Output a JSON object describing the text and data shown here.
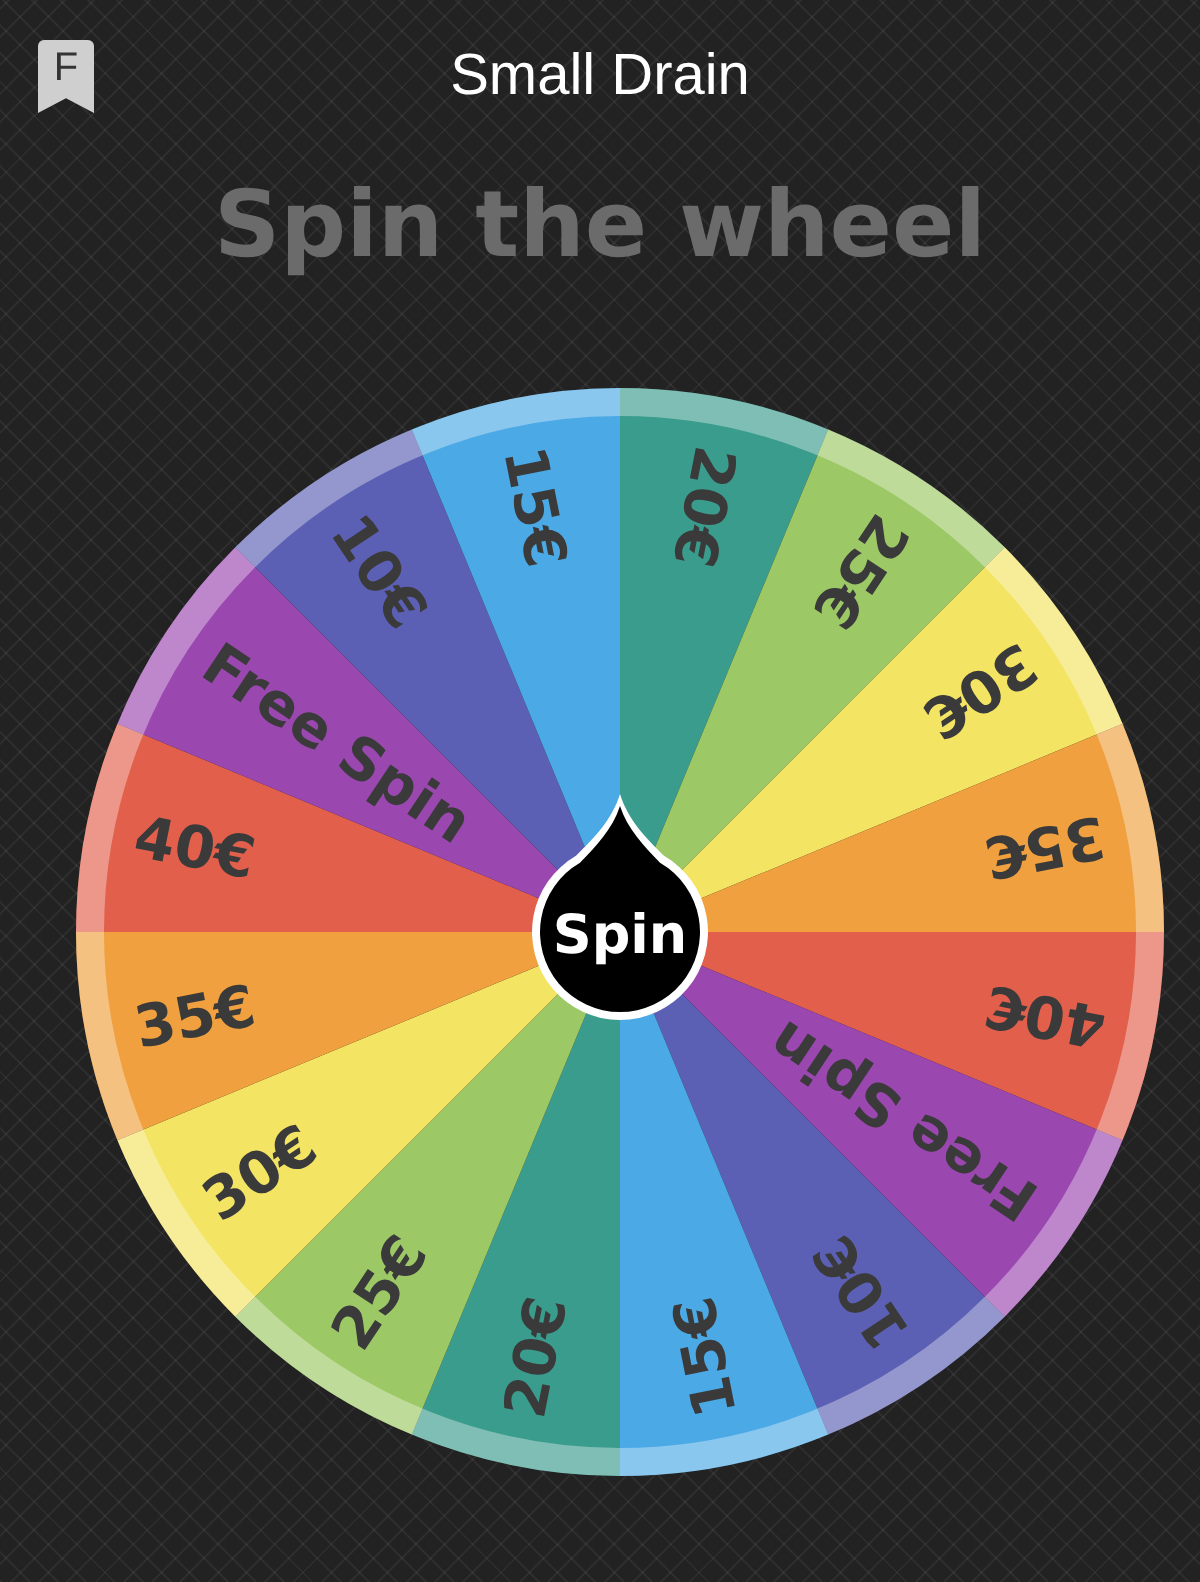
{
  "window": {
    "title": "Small Drain",
    "app_icon_letter": "F"
  },
  "heading": "Spin the wheel",
  "wheel": {
    "segments": [
      {
        "label": "20€",
        "color": "#3a9c8c"
      },
      {
        "label": "25€",
        "color": "#9cc865"
      },
      {
        "label": "30€",
        "color": "#f3e463"
      },
      {
        "label": "35€",
        "color": "#f0a03e"
      },
      {
        "label": "40€",
        "color": "#e2604b"
      },
      {
        "label": "Free Spin",
        "color": "#9b47b0"
      },
      {
        "label": "10€",
        "color": "#5b60b4"
      },
      {
        "label": "15€",
        "color": "#4ba9e6"
      },
      {
        "label": "20€",
        "color": "#3a9c8c"
      },
      {
        "label": "25€",
        "color": "#9cc865"
      },
      {
        "label": "30€",
        "color": "#f3e463"
      },
      {
        "label": "35€",
        "color": "#f0a03e"
      },
      {
        "label": "40€",
        "color": "#e2604b"
      },
      {
        "label": "Free Spin",
        "color": "#9b47b0"
      },
      {
        "label": "10€",
        "color": "#5b60b4"
      },
      {
        "label": "15€",
        "color": "#4ba9e6"
      }
    ],
    "spin_button": "Spin"
  }
}
